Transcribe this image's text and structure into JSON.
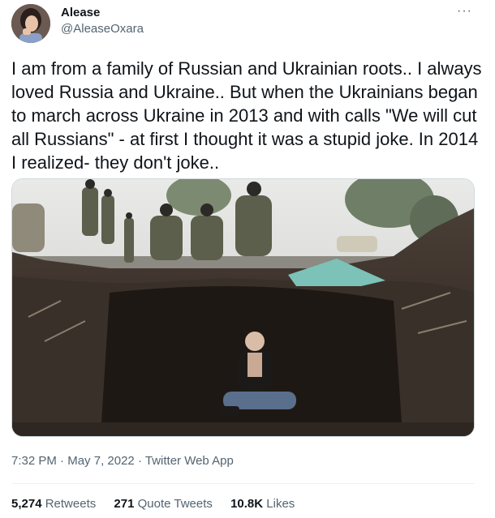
{
  "author": {
    "display_name": "Alease",
    "handle": "@AleaseOxara",
    "avatar_icon": "user-avatar"
  },
  "more_icon": "ellipsis-icon",
  "more_glyph": "···",
  "tweet": {
    "text": "I am from a family of Russian and Ukrainian roots.. I always loved Russia and Ukraine.. But when the Ukrainians began to march across Ukraine in 2013 and with calls \"We will cut all Russians\" - at first I thought it was a stupid joke. In 2014 I realized- they don't joke..",
    "time": "7:32 PM",
    "date": "May 7, 2022",
    "source": "Twitter Web App",
    "separator": "·"
  },
  "media": {
    "icon": "photo-image"
  },
  "stats": {
    "retweets_count": "5,274",
    "retweets_label": "Retweets",
    "quote_count": "271",
    "quote_label": "Quote Tweets",
    "likes_count": "10.8K",
    "likes_label": "Likes"
  },
  "colors": {
    "text_primary": "#0f1419",
    "text_secondary": "#536471",
    "divider": "#eff3f4"
  }
}
